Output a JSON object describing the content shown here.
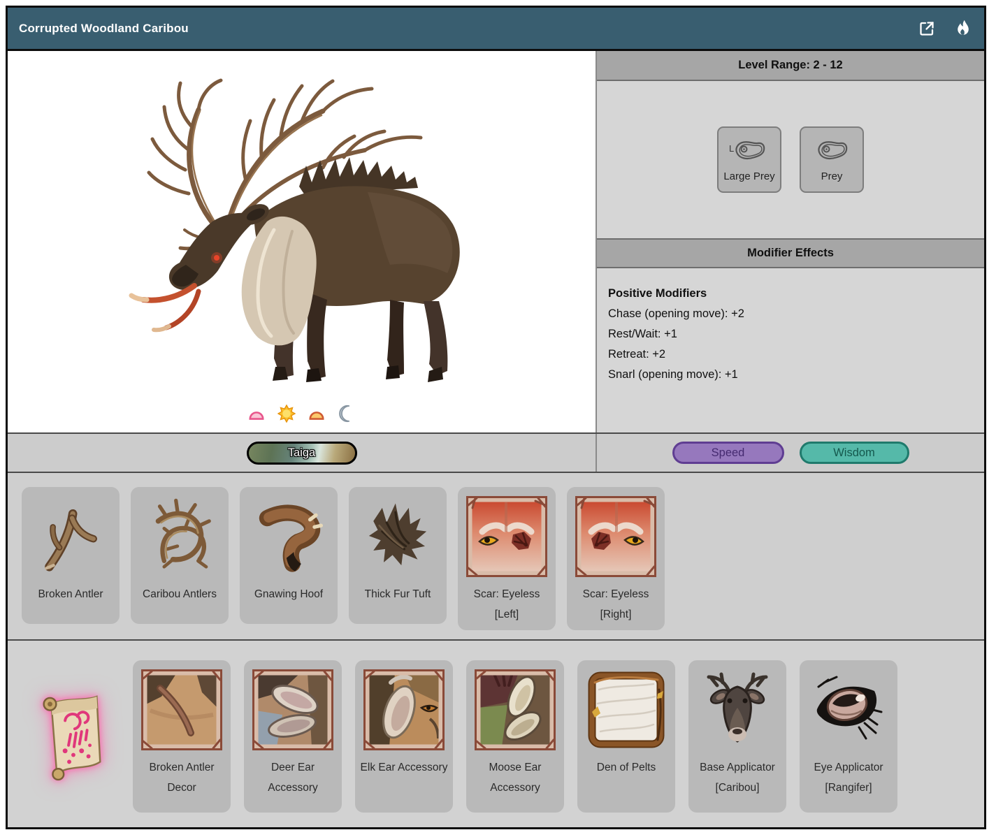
{
  "window": {
    "title": "Corrupted Woodland Caribou",
    "popout_icon": "external-link-icon",
    "flee_icon": "flame-icon"
  },
  "colors": {
    "titlebar_bg": "#395e70",
    "section_header_bg": "#a6a6a6",
    "panel_bg": "#d6d6d6",
    "card_bg": "#b9b9b9",
    "speed_fill": "#9678bd",
    "speed_border": "#5f3d92",
    "wisdom_fill": "#55b9a9",
    "wisdom_border": "#1f7a6c"
  },
  "info": {
    "level_range": "Level Range: 2 - 12",
    "prey_buttons": [
      {
        "label": "Large Prey",
        "badge": "L",
        "icon": "steak-icon"
      },
      {
        "label": "Prey",
        "badge": "",
        "icon": "steak-icon"
      }
    ],
    "modifier_header": "Modifier Effects",
    "modifiers_title": "Positive Modifiers",
    "modifiers": [
      "Chase (opening move): +2",
      "Rest/Wait: +1",
      "Retreat: +2",
      "Snarl (opening move): +1"
    ]
  },
  "image_panel": {
    "subject": "corrupted-woodland-caribou-art",
    "times_of_day": [
      "dawn",
      "day",
      "dusk",
      "night"
    ]
  },
  "biome": {
    "label": "Taiga"
  },
  "stats": [
    {
      "label": "Speed"
    },
    {
      "label": "Wisdom"
    }
  ],
  "drops": {
    "items": [
      {
        "label": "Broken Antler",
        "icon": "broken-antler-icon"
      },
      {
        "label": "Caribou Antlers",
        "icon": "caribou-antlers-icon"
      },
      {
        "label": "Gnawing Hoof",
        "icon": "gnawing-hoof-icon"
      },
      {
        "label": "Thick Fur Tuft",
        "icon": "thick-fur-tuft-icon"
      },
      {
        "label": "Scar: Eyeless [Left]",
        "icon": "scar-eyeless-left-icon"
      },
      {
        "label": "Scar: Eyeless [Right]",
        "icon": "scar-eyeless-right-icon"
      }
    ]
  },
  "crafting": {
    "recipe_icon": "recipe-scroll-icon",
    "items": [
      {
        "label": "Broken Antler Decor",
        "icon": "broken-antler-decor-icon"
      },
      {
        "label": "Deer Ear Accessory",
        "icon": "deer-ear-accessory-icon"
      },
      {
        "label": "Elk Ear Accessory",
        "icon": "elk-ear-accessory-icon"
      },
      {
        "label": "Moose Ear Accessory",
        "icon": "moose-ear-accessory-icon"
      },
      {
        "label": "Den of Pelts",
        "icon": "den-of-pelts-icon"
      },
      {
        "label": "Base Applicator [Caribou]",
        "icon": "base-applicator-caribou-icon"
      },
      {
        "label": "Eye Applicator [Rangifer]",
        "icon": "eye-applicator-rangifer-icon"
      }
    ]
  }
}
